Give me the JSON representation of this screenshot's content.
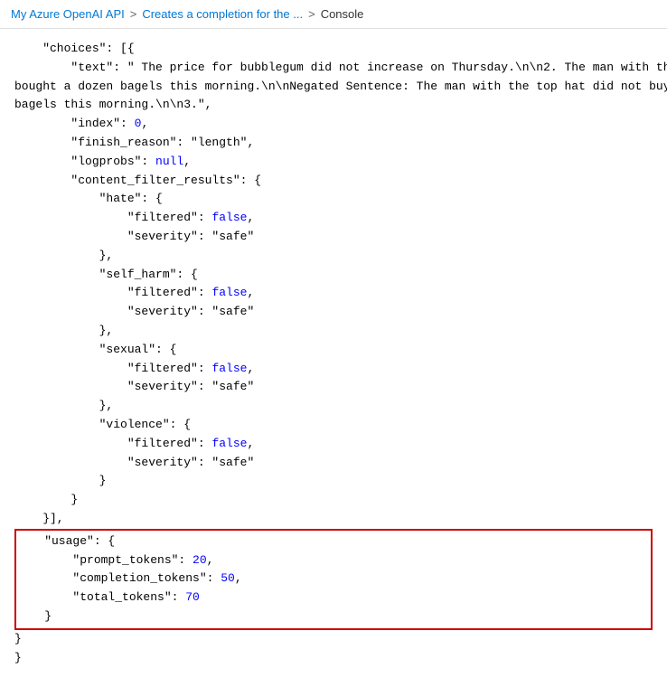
{
  "breadcrumb": {
    "item1": "My Azure OpenAI API",
    "sep1": ">",
    "item2": "Creates a completion for the ...",
    "sep2": ">",
    "current": "Console"
  },
  "code": {
    "lines": [
      {
        "indent": 2,
        "content": "\"choices\": [{"
      },
      {
        "indent": 4,
        "content": "\"text\": \" The price for bubblegum did not increase on Thursday.\\n\\n2. The man with the top hat"
      },
      {
        "indent": 0,
        "content": "bought a dozen bagels this morning.\\n\\nNegated Sentence: The man with the top hat did not buy a dozen"
      },
      {
        "indent": 0,
        "content": "bagels this morning.\\n\\n3.\","
      },
      {
        "indent": 4,
        "content": "\"index\": 0,"
      },
      {
        "indent": 4,
        "content": "\"finish_reason\": \"length\","
      },
      {
        "indent": 4,
        "content": "\"logprobs\": null,"
      },
      {
        "indent": 4,
        "content": "\"content_filter_results\": {"
      },
      {
        "indent": 6,
        "content": "\"hate\": {"
      },
      {
        "indent": 8,
        "content": "\"filtered\": false,"
      },
      {
        "indent": 8,
        "content": "\"severity\": \"safe\""
      },
      {
        "indent": 6,
        "content": "},"
      },
      {
        "indent": 6,
        "content": "\"self_harm\": {"
      },
      {
        "indent": 8,
        "content": "\"filtered\": false,"
      },
      {
        "indent": 8,
        "content": "\"severity\": \"safe\""
      },
      {
        "indent": 6,
        "content": "},"
      },
      {
        "indent": 6,
        "content": "\"sexual\": {"
      },
      {
        "indent": 8,
        "content": "\"filtered\": false,"
      },
      {
        "indent": 8,
        "content": "\"severity\": \"safe\""
      },
      {
        "indent": 6,
        "content": "},"
      },
      {
        "indent": 6,
        "content": "\"violence\": {"
      },
      {
        "indent": 8,
        "content": "\"filtered\": false,"
      },
      {
        "indent": 8,
        "content": "\"severity\": \"safe\""
      },
      {
        "indent": 6,
        "content": "}"
      },
      {
        "indent": 4,
        "content": "}"
      },
      {
        "indent": 2,
        "content": "}],"
      },
      {
        "indent": 2,
        "content": "\"usage\": {",
        "highlight_start": true
      },
      {
        "indent": 4,
        "content": "\"prompt_tokens\": 20,"
      },
      {
        "indent": 4,
        "content": "\"completion_tokens\": 50,"
      },
      {
        "indent": 4,
        "content": "\"total_tokens\": 70"
      },
      {
        "indent": 2,
        "content": "}",
        "highlight_end": true
      },
      {
        "indent": 0,
        "content": "}"
      }
    ]
  }
}
